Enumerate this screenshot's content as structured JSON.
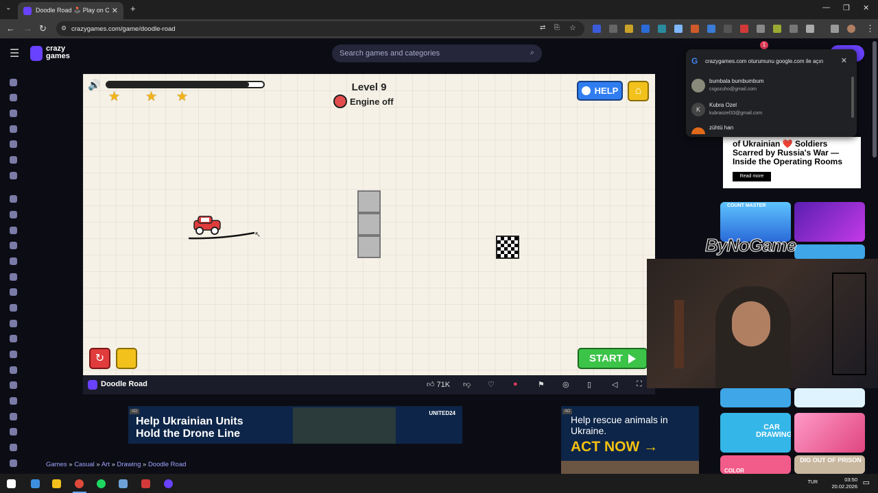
{
  "browser": {
    "tab_title": "Doodle Road 🕹️ Play on CrazyGames",
    "url": "crazygames.com/game/doodle-road"
  },
  "site": {
    "logo_line1": "crazy",
    "logo_line2": "games",
    "search_placeholder": "Search games and categories",
    "notification_count": "1"
  },
  "game": {
    "level": "Level 9",
    "engine_status": "Engine off",
    "help_label": "HELP",
    "start_label": "START",
    "progress_fraction": 0.91,
    "stars": 3
  },
  "gamebar": {
    "title": "Doodle Road",
    "likes": "71K"
  },
  "google_popup": {
    "header": "crazygames.com oturumunu google.com ile açın",
    "accounts": [
      {
        "name": "bumbala bumbumbum",
        "email": "csgozuho@gmail.com",
        "initial": ""
      },
      {
        "name": "Kubra Ozel",
        "email": "kubraozel33@gmail.com",
        "initial": "K"
      },
      {
        "name": "zühtü han",
        "email": "",
        "initial": ""
      }
    ]
  },
  "ads": {
    "tag": "AD",
    "ad1_text": "Help Ukrainian Units Hold the Drone Line",
    "ad1_brand": "UNITED24",
    "ad2_line1": "Help rescue animals in Ukraine.",
    "ad2_cta": "ACT NOW →",
    "ad3_text": "of Ukrainian ❤️ Soldiers Scarred by Russia's War —Inside the Operating Rooms",
    "ad3_button": "Read more"
  },
  "breadcrumb": [
    "Games",
    "Casual",
    "Art",
    "Drawing",
    "Doodle Road"
  ],
  "thumbnails": {
    "count_master": "COUNT MASTER",
    "car_drawing": "CAR DRAWING",
    "color": "COLOR",
    "dig_out": "DIG OUT OF PRISON"
  },
  "overlay": {
    "watermark": "ByNoGame"
  },
  "taskbar": {
    "lang": "TUR",
    "time": "03:50",
    "date": "20.02.2026"
  }
}
